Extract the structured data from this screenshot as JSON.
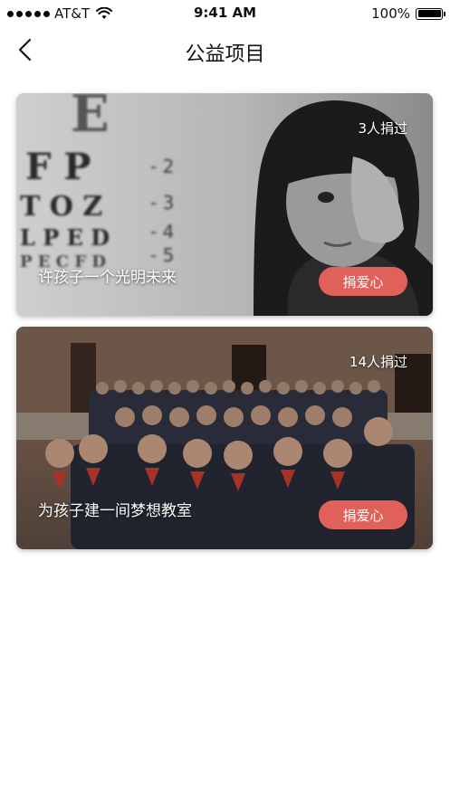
{
  "status_bar": {
    "carrier": "AT&T",
    "time": "9:41 AM",
    "battery": "100%"
  },
  "nav": {
    "title": "公益项目"
  },
  "projects": [
    {
      "title": "许孩子一个光明未来",
      "donors": "3人捐过",
      "button": "捐爱心",
      "chart_lines": [
        "E",
        "F P",
        "T O Z",
        "L P E D",
        "P E C F D"
      ]
    },
    {
      "title": "为孩子建一间梦想教室",
      "donors": "14人捐过",
      "button": "捐爱心"
    }
  ],
  "colors": {
    "accent": "#e0615a"
  }
}
